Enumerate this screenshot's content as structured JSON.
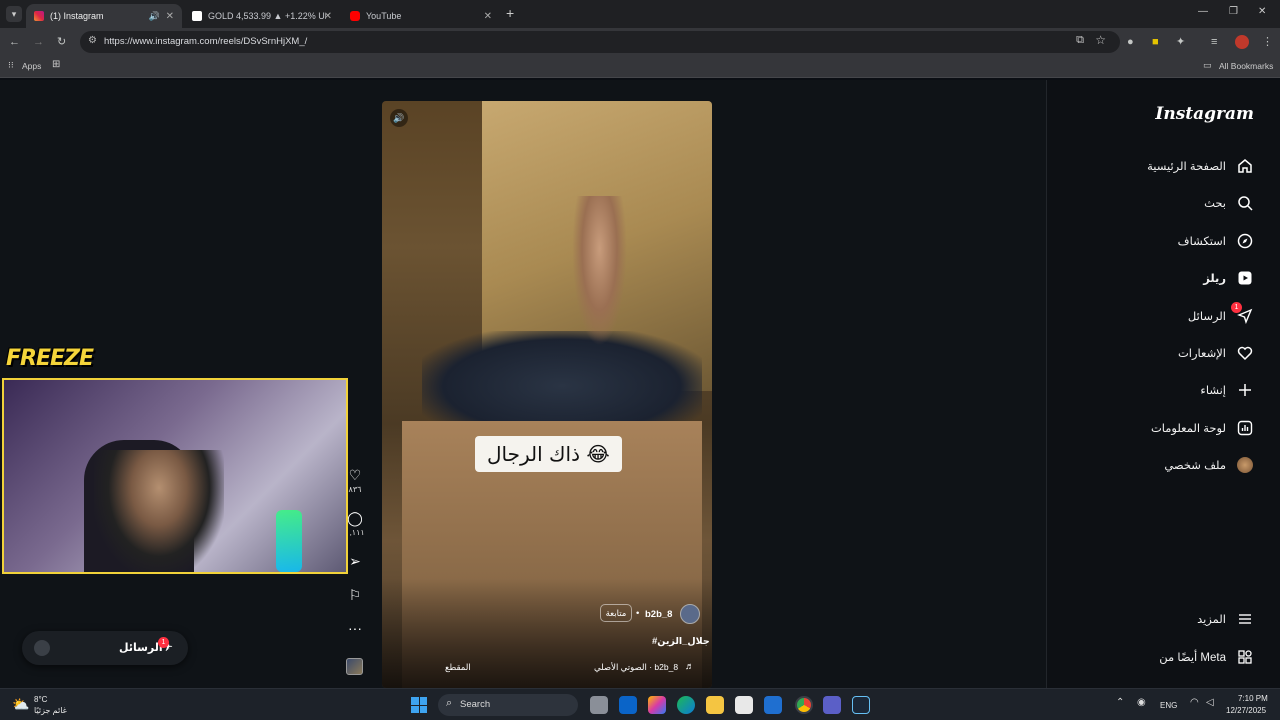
{
  "browser": {
    "tabs": [
      {
        "title": "(1) Instagram",
        "active": true
      },
      {
        "title": "GOLD 4,533.99 ▲ +1.22% Unn",
        "active": false
      },
      {
        "title": "YouTube",
        "active": false
      }
    ],
    "new_tab": "+",
    "url": "https://www.instagram.com/reels/DSvSrnHjXM_/",
    "bookmarks": {
      "apps": "Apps",
      "all": "All Bookmarks"
    }
  },
  "sidebar": {
    "logo": "Instagram",
    "items": [
      {
        "label": "الصفحة الرئيسية",
        "icon": "home-icon"
      },
      {
        "label": "بحث",
        "icon": "search-icon"
      },
      {
        "label": "استكشاف",
        "icon": "compass-icon"
      },
      {
        "label": "ريلز",
        "icon": "reels-icon"
      },
      {
        "label": "الرسائل",
        "icon": "messenger-icon",
        "badge": "1"
      },
      {
        "label": "الإشعارات",
        "icon": "heart-icon"
      },
      {
        "label": "إنشاء",
        "icon": "plus-icon"
      },
      {
        "label": "لوحة المعلومات",
        "icon": "dashboard-icon"
      },
      {
        "label": "ملف شخصي",
        "icon": "avatar-icon"
      }
    ],
    "more": "المزيد",
    "also_meta": "أيضًا من Meta"
  },
  "reel": {
    "caption": "ذاك الرجال 😂",
    "username": "b2b_8",
    "follow": "متابعة",
    "hashtag": "#جلال_الزين",
    "audio": "الصوتي الأصلي · b2b_8",
    "clip_label": "المقطع",
    "likes": "٨٣٦",
    "comments": "١,١١١"
  },
  "overlay": {
    "freeze": "FREEZE",
    "messages_label": "الرسائل",
    "messages_badge": "1"
  },
  "taskbar": {
    "search": "Search",
    "weather_temp": "8°C",
    "weather_desc": "غائم جزئيًا",
    "lang": "ENG",
    "time": "7:10 PM",
    "date": "12/27/2025"
  }
}
